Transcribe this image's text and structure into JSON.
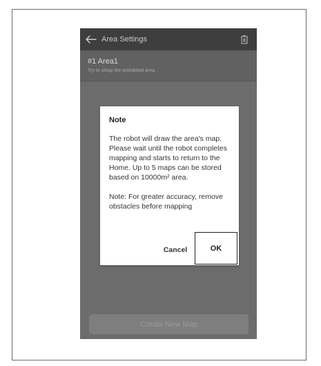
{
  "header": {
    "back_icon": "arrow-left-icon",
    "title": "Area Settings",
    "trash_icon": "trash-icon"
  },
  "area": {
    "name": "#1 Area1",
    "hint": "Try to setup the prohibited area."
  },
  "dialog": {
    "title": "Note",
    "paragraph1": "The robot will draw the area's map. Please wait until the robot completes mapping and starts to return to the Home. Up to 5 maps can be stored based on 10000m² area.",
    "paragraph2": "Note: For greater accuracy, remove obstacles before mapping",
    "cancel_label": "Cancel",
    "ok_label": "OK"
  },
  "footer": {
    "create_label": "Create New Map"
  },
  "colors": {
    "overlay": "#6c6c6c",
    "appbar": "#3e3e3e",
    "dialog": "#ffffff"
  }
}
